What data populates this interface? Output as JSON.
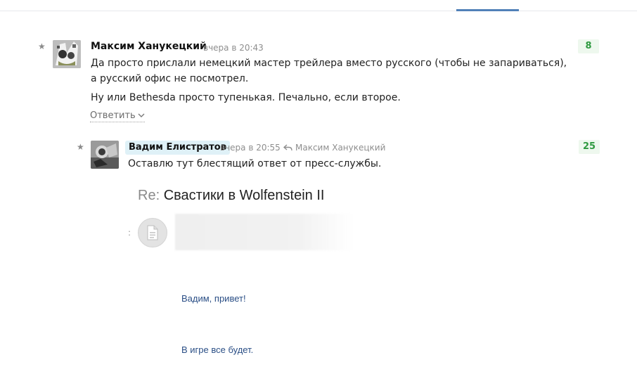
{
  "comment_main": {
    "author": "Максим Ханукецкий",
    "time": "вчера в 20:43",
    "score": "8",
    "text_line1": "Да просто прислали немецкий мастер трейлера вместо русского (чтобы не запариваться),",
    "text_line2": "а русский офис не посмотрел.",
    "text_line3": "Ну или Bethesda просто тупенькая. Печально, если второе.",
    "reply_label": "Ответить"
  },
  "comment_reply": {
    "author": "Вадим Елистратов",
    "time": "вчера в 20:55",
    "reply_to": "Максим Ханукецкий",
    "score": "25",
    "text": "Оставлю тут блестящий ответ от пресс-службы."
  },
  "embedded_email": {
    "subject_prefix": "Re:",
    "subject": "Свастики в Wolfenstein II",
    "greeting": "Вадим, привет!",
    "body_line": "В игре все будет."
  },
  "colors": {
    "accent": "#5181b8",
    "score_bg": "#eef8ee",
    "score_text": "#2f9a40",
    "author_highlight": "#dff1f7",
    "email_text": "#2b4f86"
  },
  "icons": [
    "star-icon",
    "chevron-down-icon",
    "reply-arrow-icon",
    "document-icon"
  ]
}
